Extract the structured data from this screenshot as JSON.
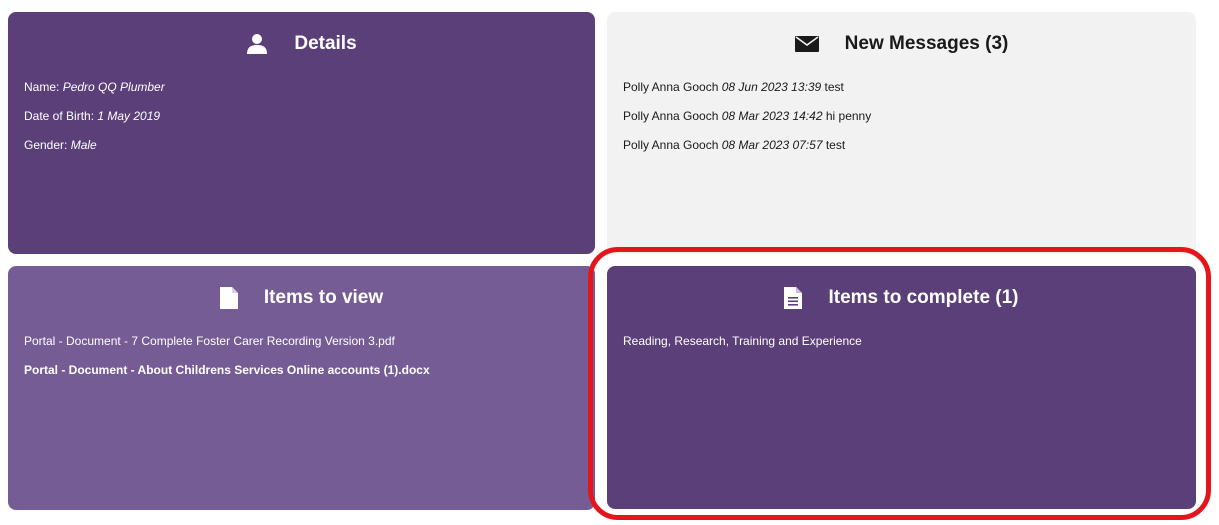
{
  "details": {
    "title": "Details",
    "icon": "user-icon",
    "name_label": "Name:",
    "name_value": "Pedro QQ Plumber",
    "dob_label": "Date of Birth:",
    "dob_value": "1 May 2019",
    "gender_label": "Gender:",
    "gender_value": "Male"
  },
  "messages": {
    "title": "New Messages (3)",
    "icon": "envelope-icon",
    "items": [
      {
        "sender": "Polly Anna Gooch",
        "date": "08 Jun 2023 13:39",
        "text": "test"
      },
      {
        "sender": "Polly Anna Gooch",
        "date": "08 Mar 2023 14:42",
        "text": "hi penny"
      },
      {
        "sender": "Polly Anna Gooch",
        "date": "08 Mar 2023 07:57",
        "text": "test"
      }
    ]
  },
  "items_to_view": {
    "title": "Items to view",
    "icon": "document-icon",
    "items": [
      {
        "text": "Portal - Document - 7 Complete Foster Carer Recording Version 3.pdf",
        "bold": false
      },
      {
        "text": "Portal - Document - About Childrens Services Online accounts (1).docx",
        "bold": true
      }
    ]
  },
  "items_to_complete": {
    "title": "Items to complete (1)",
    "icon": "document-text-icon",
    "items": [
      {
        "text": "Reading, Research, Training and Experience"
      }
    ]
  },
  "colors": {
    "purple_dark": "#5b3f79",
    "purple_light": "#765c95",
    "grey_panel": "#f2f2f2",
    "highlight_red": "#e5161b"
  }
}
